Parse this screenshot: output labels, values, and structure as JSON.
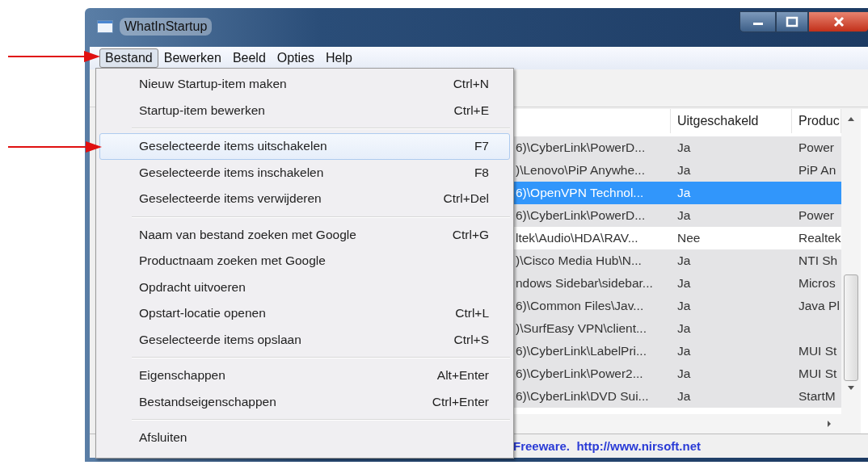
{
  "window": {
    "title": "WhatInStartup"
  },
  "menubar": [
    {
      "label": "Bestand",
      "selected": true
    },
    {
      "label": "Bewerken",
      "selected": false
    },
    {
      "label": "Beeld",
      "selected": false
    },
    {
      "label": "Opties",
      "selected": false
    },
    {
      "label": "Help",
      "selected": false
    }
  ],
  "file_menu": [
    {
      "kind": "item",
      "label": "Nieuw Startup-item maken",
      "shortcut": "Ctrl+N",
      "selected": false
    },
    {
      "kind": "item",
      "label": "Startup-item bewerken",
      "shortcut": "Ctrl+E",
      "selected": false
    },
    {
      "kind": "separator"
    },
    {
      "kind": "item",
      "label": "Geselecteerde items uitschakelen",
      "shortcut": "F7",
      "selected": true
    },
    {
      "kind": "item",
      "label": "Geselecteerde items inschakelen",
      "shortcut": "F8",
      "selected": false
    },
    {
      "kind": "item",
      "label": "Geselecteerde items verwijderen",
      "shortcut": "Ctrl+Del",
      "selected": false
    },
    {
      "kind": "separator"
    },
    {
      "kind": "item",
      "label": "Naam van bestand zoeken met Google",
      "shortcut": "Ctrl+G",
      "selected": false
    },
    {
      "kind": "item",
      "label": "Productnaam zoeken met Google",
      "selected": false
    },
    {
      "kind": "item",
      "label": "Opdracht uitvoeren",
      "selected": false
    },
    {
      "kind": "item",
      "label": "Opstart-locatie openen",
      "shortcut": "Ctrl+L",
      "selected": false
    },
    {
      "kind": "item",
      "label": "Geselecteerde items opslaan",
      "shortcut": "Ctrl+S",
      "selected": false
    },
    {
      "kind": "separator"
    },
    {
      "kind": "item",
      "label": "Eigenschappen",
      "shortcut": "Alt+Enter",
      "selected": false
    },
    {
      "kind": "item",
      "label": "Bestandseigenschappen",
      "shortcut": "Ctrl+Enter",
      "selected": false
    },
    {
      "kind": "separator"
    },
    {
      "kind": "item",
      "label": "Afsluiten",
      "selected": false
    }
  ],
  "table": {
    "columns": [
      "Uitgeschakeld",
      "Produc"
    ],
    "rows": [
      {
        "column_1": "6)\\CyberLink\\PowerD...",
        "disabled_value": "Ja",
        "product": "Power",
        "disabled": true,
        "selected": false
      },
      {
        "column_1": ")\\Lenovo\\PiP Anywhe...",
        "disabled_value": "Ja",
        "product": "PiP An",
        "disabled": true,
        "selected": false
      },
      {
        "column_1": "6)\\OpenVPN Technol...",
        "disabled_value": "Ja",
        "disabled": true,
        "selected": true
      },
      {
        "column_1": "6)\\CyberLink\\PowerD...",
        "disabled_value": "Ja",
        "product": "Power",
        "disabled": true,
        "selected": false
      },
      {
        "column_1": "ltek\\Audio\\HDA\\RAV...",
        "disabled_value": "Nee",
        "product": "Realtek",
        "disabled": false,
        "selected": false
      },
      {
        "column_1": ")\\Cisco Media Hub\\N...",
        "disabled_value": "Ja",
        "product": "NTI Sh",
        "disabled": true,
        "selected": false
      },
      {
        "column_1": "ndows Sidebar\\sidebar...",
        "disabled_value": "Ja",
        "product": "Micros",
        "disabled": true,
        "selected": false
      },
      {
        "column_1": "6)\\Common Files\\Jav...",
        "disabled_value": "Ja",
        "product": "Java Pl",
        "disabled": true,
        "selected": false
      },
      {
        "column_1": ")\\SurfEasy VPN\\client...",
        "disabled_value": "Ja",
        "disabled": true,
        "selected": false
      },
      {
        "column_1": "6)\\CyberLink\\LabelPri...",
        "disabled_value": "Ja",
        "product": "MUI St",
        "disabled": true,
        "selected": false
      },
      {
        "column_1": "6)\\CyberLink\\Power2...",
        "disabled_value": "Ja",
        "product": "MUI St",
        "disabled": true,
        "selected": false
      },
      {
        "column_1": "6)\\CyberLink\\DVD Sui...",
        "disabled_value": "Ja",
        "product": "StartM",
        "disabled": true,
        "selected": false
      }
    ]
  },
  "status_bar": {
    "text": "Freeware.  http://www.nirsoft.net"
  }
}
